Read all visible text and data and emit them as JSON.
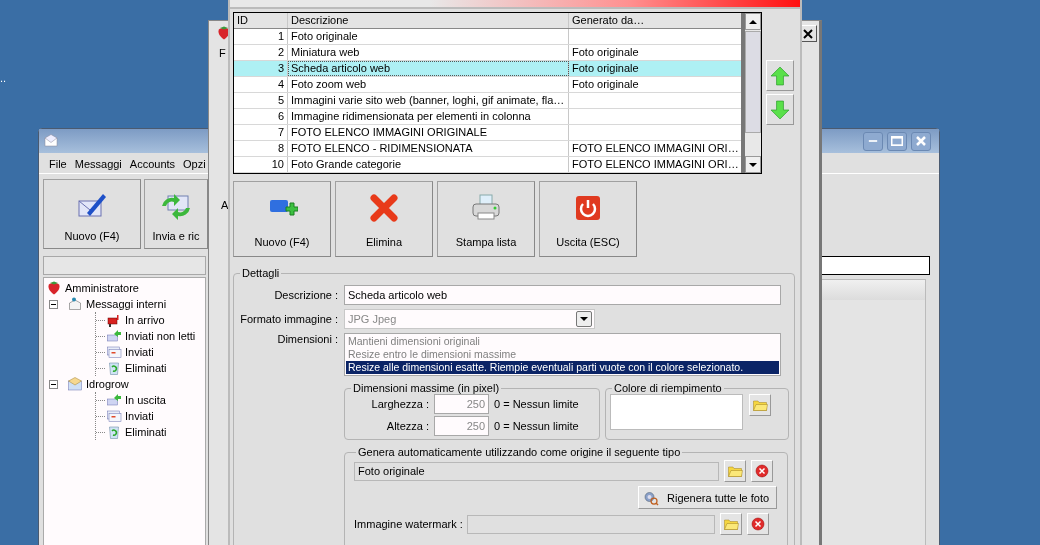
{
  "desktop": {
    "label": ".."
  },
  "mail_window": {
    "menu": [
      "File",
      "Messaggi",
      "Accounts",
      "Opzi"
    ],
    "toolbar": [
      {
        "label": "Nuovo (F4)",
        "kind": "compose"
      },
      {
        "label": "Invia e ric",
        "kind": "sendreceive"
      }
    ],
    "tree": [
      {
        "label": "Amministratore",
        "kind": "root",
        "expanded": false,
        "children": [
          {
            "label": "Messaggi interni",
            "kind": "internal",
            "expanded": true,
            "children": [
              {
                "label": "In arrivo",
                "kind": "inbox"
              },
              {
                "label": "Inviati non letti",
                "kind": "outbox"
              },
              {
                "label": "Inviati",
                "kind": "sent"
              },
              {
                "label": "Eliminati",
                "kind": "trash"
              }
            ]
          },
          {
            "label": "Idrogrow",
            "kind": "account",
            "expanded": true,
            "children": [
              {
                "label": "In uscita",
                "kind": "outbox"
              },
              {
                "label": "Inviati",
                "kind": "sent"
              },
              {
                "label": "Eliminati",
                "kind": "trash"
              }
            ]
          }
        ]
      }
    ]
  },
  "back_window": {
    "fragments": [
      "F",
      "A"
    ]
  },
  "image_types_window": {
    "table": {
      "columns": [
        "ID",
        "Descrizione",
        "Generato da…"
      ],
      "rows": [
        {
          "id": "1",
          "description": "Foto originale",
          "generated_by": "",
          "selected": false
        },
        {
          "id": "2",
          "description": "Miniatura web",
          "generated_by": "Foto originale",
          "selected": false
        },
        {
          "id": "3",
          "description": "Scheda articolo web",
          "generated_by": "Foto originale",
          "selected": true
        },
        {
          "id": "4",
          "description": "Foto zoom web",
          "generated_by": "Foto originale",
          "selected": false
        },
        {
          "id": "5",
          "description": "Immagini varie sito web (banner, loghi, gif animate, fla…",
          "generated_by": "",
          "selected": false
        },
        {
          "id": "6",
          "description": "Immagine ridimensionata per elementi in colonna",
          "generated_by": "",
          "selected": false
        },
        {
          "id": "7",
          "description": "FOTO ELENCO IMMAGINI ORIGINALE",
          "generated_by": "",
          "selected": false
        },
        {
          "id": "8",
          "description": "FOTO ELENCO - RIDIMENSIONATA",
          "generated_by": "FOTO ELENCO IMMAGINI ORI…",
          "selected": false
        },
        {
          "id": "10",
          "description": "Foto Grande categorie",
          "generated_by": "FOTO ELENCO IMMAGINI ORI…",
          "selected": false
        }
      ]
    },
    "toolbar": [
      {
        "label": "Nuovo (F4)",
        "kind": "new"
      },
      {
        "label": "Elimina",
        "kind": "delete"
      },
      {
        "label": "Stampa lista",
        "kind": "print"
      },
      {
        "label": "Uscita (ESC)",
        "kind": "exit"
      }
    ],
    "details": {
      "title": "Dettagli",
      "description": {
        "label": "Descrizione :",
        "value": "Scheda articolo web"
      },
      "format": {
        "label": "Formato immagine :",
        "value": "JPG Jpeg",
        "disabled": true
      },
      "dimensions": {
        "label": "Dimensioni :",
        "options": [
          {
            "label": "Mantieni dimensioni originali",
            "selected": false
          },
          {
            "label": "Resize entro le dimensioni massime",
            "selected": false
          },
          {
            "label": "Resize alle dimensioni esatte. Riempie eventuali parti vuote con il colore selezionato.",
            "selected": true
          }
        ]
      },
      "max_size": {
        "title": "Dimensioni massime (in pixel)",
        "rows": [
          {
            "label": "Larghezza :",
            "value": "250",
            "hint": "0 = Nessun limite",
            "disabled": true
          },
          {
            "label": "Altezza :",
            "value": "250",
            "hint": "0 = Nessun limite",
            "disabled": true
          }
        ]
      },
      "fill_color": {
        "title": "Colore di riempimento",
        "color": "#ffffff"
      },
      "auto_generate": {
        "title": "Genera automaticamente utilizzando come origine il seguente tipo",
        "source": "Foto originale",
        "regenerate_button": "Rigenera tutte le foto",
        "watermark_label": "Immagine watermark :"
      }
    }
  }
}
